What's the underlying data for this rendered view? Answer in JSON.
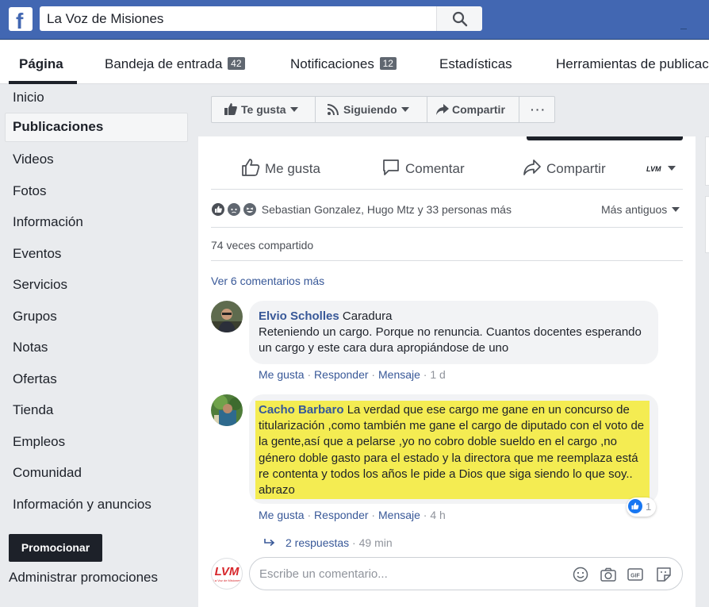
{
  "search": {
    "value": "La Voz de Misiones"
  },
  "tabs": [
    {
      "label": "Página"
    },
    {
      "label": "Bandeja de entrada",
      "badge": "42"
    },
    {
      "label": "Notificaciones",
      "badge": "12"
    },
    {
      "label": "Estadísticas"
    },
    {
      "label": "Herramientas de publicación"
    }
  ],
  "sidebar": {
    "items": [
      "Inicio",
      "Publicaciones",
      "Videos",
      "Fotos",
      "Información",
      "Eventos",
      "Servicios",
      "Grupos",
      "Notas",
      "Ofertas",
      "Tienda",
      "Empleos",
      "Comunidad",
      "Información y anuncios"
    ],
    "promote_label": "Promocionar",
    "manage_promotions": "Administrar promociones"
  },
  "page_actions": {
    "like": "Te gusta",
    "following": "Siguiendo",
    "share": "Compartir",
    "more": "···"
  },
  "post": {
    "actions": {
      "like": "Me gusta",
      "comment": "Comentar",
      "share": "Compartir",
      "page_mini_logo": "LVM"
    },
    "reactions_summary": "Sebastian Gonzalez, Hugo Mtz y 33 personas más",
    "sort_label": "Más antiguos",
    "shares_text": "74 veces compartido",
    "view_more_comments": "Ver 6 comentarios más",
    "comments": [
      {
        "author": "Elvio Scholles",
        "text_first": "Caradura",
        "text_rest": "Reteniendo un cargo. Porque no renuncia. Cuantos docentes esperando un cargo y este cara dura apropiándose de uno",
        "like": "Me gusta",
        "reply": "Responder",
        "message": "Mensaje",
        "time": "1 d"
      },
      {
        "author": "Cacho Barbaro",
        "text": "La verdad que ese cargo me gane en un concurso de titularización ,como también me gane el cargo de diputado con el voto de la gente,así que a pelarse ,yo no cobro doble sueldo en el cargo ,no género doble gasto para el estado y la directora que me reemplaza está re contenta y todos los años le pide a Dios que siga siendo lo que soy.. abrazo",
        "like": "Me gusta",
        "reply": "Responder",
        "message": "Mensaje",
        "time": "4 h",
        "like_count": "1",
        "replies_label": "2 respuestas",
        "replies_time": "49 min"
      }
    ],
    "composer": {
      "placeholder": "Escribe un comentario...",
      "logo_text": "LVM",
      "logo_subtext": "La Voz de Misiones"
    }
  },
  "colors": {
    "brand_blue": "#4267b2",
    "link_blue": "#385898",
    "highlight_yellow": "#f4ec52"
  }
}
